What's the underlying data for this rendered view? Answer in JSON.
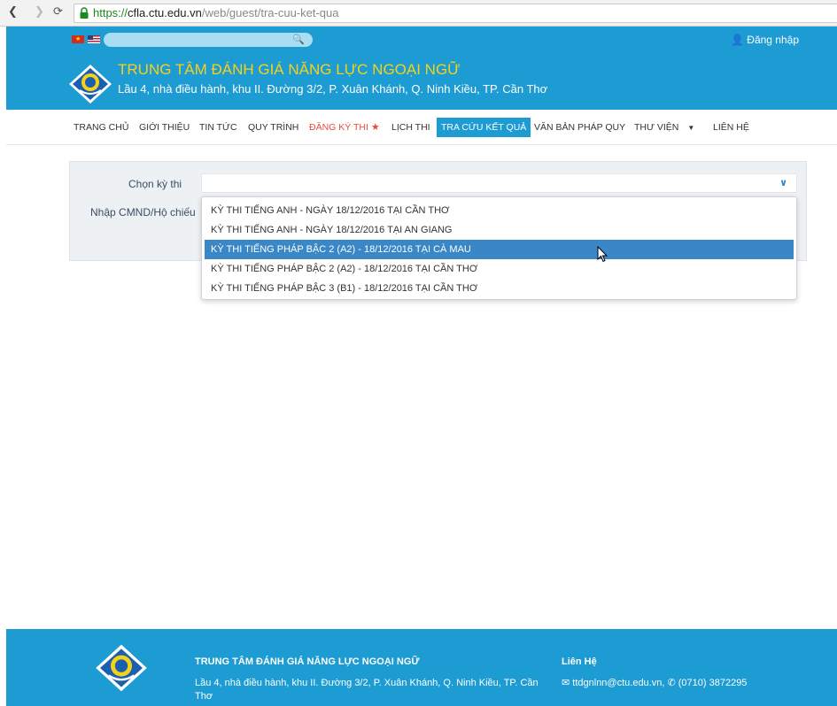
{
  "browser": {
    "url_scheme": "https://",
    "url_host": "cfla.ctu.edu.vn",
    "url_path": "/web/guest/tra-cuu-ket-qua"
  },
  "header": {
    "login_label": "Đăng nhập",
    "title": "TRUNG TÂM ĐÁNH GIÁ NĂNG LỰC NGOẠI NGỮ",
    "address": "Lầu 4, nhà điều hành, khu II. Đường 3/2, P. Xuân Khánh, Q. Ninh Kiều, TP. Cần Thơ"
  },
  "menu": {
    "items": [
      {
        "label": "TRANG CHỦ"
      },
      {
        "label": "GIỚI THIỆU"
      },
      {
        "label": "TIN TỨC"
      },
      {
        "label": "QUY TRÌNH"
      },
      {
        "label": "ĐĂNG KÝ THI"
      },
      {
        "label": "LỊCH THI"
      },
      {
        "label": "TRA CỨU KẾT QUẢ"
      },
      {
        "label": "VĂN BẢN PHÁP QUY"
      },
      {
        "label": "THƯ VIỆN"
      },
      {
        "label": "LIÊN HỆ"
      }
    ]
  },
  "form": {
    "exam_label": "Chọn kỳ thi",
    "id_label": "Nhập CMND/Hộ chiếu",
    "exam_value": "",
    "options": [
      "KỲ THI TIẾNG ANH - NGÀY 18/12/2016 TẠI CẦN THƠ",
      "KỲ THI TIẾNG ANH - NGÀY 18/12/2016 TẠI AN GIANG",
      "KỲ THI TIẾNG PHÁP BẬC 2 (A2) - 18/12/2016 TẠI CÀ MAU",
      "KỲ THI TIẾNG PHÁP BẬC 2 (A2) - 18/12/2016 TẠI CẦN THƠ",
      "KỲ THI TIẾNG PHÁP BẬC 3 (B1) - 18/12/2016 TẠI CẦN THƠ"
    ],
    "highlighted_index": 2
  },
  "footer": {
    "title": "TRUNG TÂM ĐÁNH GIÁ NĂNG LỰC NGOẠI NGỮ",
    "address": "Lầu 4, nhà điều hành, khu II. Đường 3/2, P. Xuân Khánh, Q. Ninh Kiều, TP. Cần Thơ",
    "contact_heading": "Liên Hệ",
    "email": "ttdgnlnn@ctu.edu.vn,",
    "phone": "(0710) 3872295"
  },
  "colors": {
    "primary": "#1d9bd3",
    "title_yellow": "#f5d21a",
    "register_red": "#e74c3c",
    "option_highlight": "#3a87c7"
  }
}
